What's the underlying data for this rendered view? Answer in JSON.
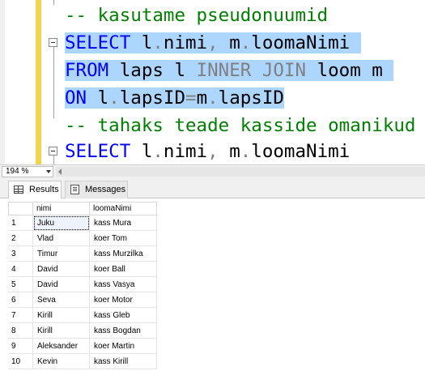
{
  "editor": {
    "lines": [
      {
        "comment": "-- kasutame pseudonuumid"
      },
      {
        "kw1": "SELECT",
        "t1": " l",
        "g1": ".",
        "t2": "nimi",
        "g2": ",",
        "t3": " m",
        "g3": ".",
        "t4": "loomaNimi"
      },
      {
        "kw1": "FROM",
        "t1": " laps l ",
        "g1": "INNER JOIN",
        "t2": " loom m"
      },
      {
        "kw1": "ON",
        "t1": " l",
        "g1": ".",
        "t2": "lapsID",
        "g2": "=",
        "t3": "m",
        "g3": ".",
        "t4": "lapsID"
      },
      {
        "comment": "-- tahaks teade kasside omanikud"
      },
      {
        "kw1": "SELECT",
        "t1": " l",
        "g1": ".",
        "t2": "nimi",
        "g2": ",",
        "t3": " m",
        "g3": ".",
        "t4": "loomaNimi"
      }
    ]
  },
  "zoom": "194 %",
  "tabs": [
    {
      "label": "Results",
      "icon": "grid-icon"
    },
    {
      "label": "Messages",
      "icon": "messages-icon"
    }
  ],
  "results": {
    "columns": [
      "nimi",
      "loomaNimi"
    ],
    "rows": [
      [
        "1",
        "Juku",
        "kass Mura"
      ],
      [
        "2",
        "Vlad",
        "koer Tom"
      ],
      [
        "3",
        "Timur",
        "kass Murzilka"
      ],
      [
        "4",
        "David",
        "koer Ball"
      ],
      [
        "5",
        "David",
        "kass Vasya"
      ],
      [
        "6",
        "Seva",
        "koer Motor"
      ],
      [
        "7",
        "Kirill",
        "kass Gleb"
      ],
      [
        "8",
        "Kirill",
        "kass Bogdan"
      ],
      [
        "9",
        "Aleksander",
        "koer Martin"
      ],
      [
        "10",
        "Kevin",
        "kass Kirill"
      ]
    ]
  },
  "colors": {
    "keyword": "#0000ff",
    "comment": "#008000",
    "operator": "#808080",
    "selection": "#add6ff"
  }
}
